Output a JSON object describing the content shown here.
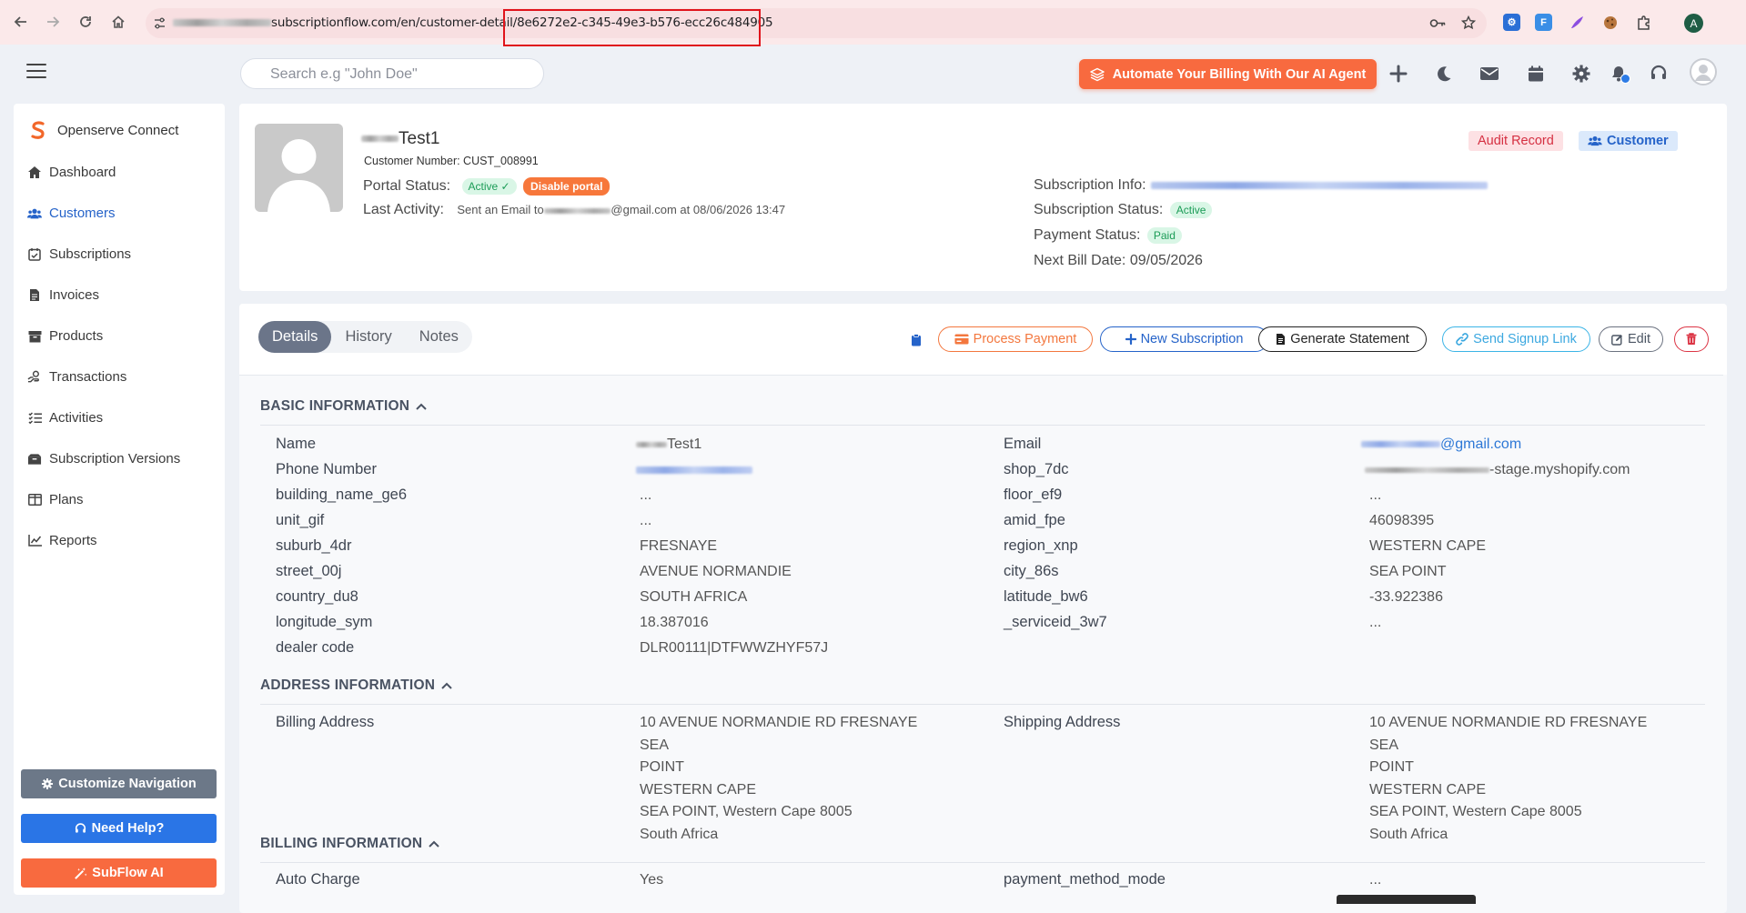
{
  "browser": {
    "url_visible": "subscriptionflow.com/en/customer-detail/",
    "url_id": "8e6272e2-c345-49e3-b576-ecc26c484905",
    "profile_initial": "A"
  },
  "header": {
    "search_placeholder": "Search e.g \"John Doe\"",
    "promo_label": "Automate Your Billing With Our AI Agent"
  },
  "sidebar": {
    "brand": "Openserve Connect",
    "items": [
      {
        "label": "Dashboard",
        "icon": "home-icon"
      },
      {
        "label": "Customers",
        "icon": "users-icon",
        "active": true
      },
      {
        "label": "Subscriptions",
        "icon": "calendar-check-icon"
      },
      {
        "label": "Invoices",
        "icon": "invoice-icon"
      },
      {
        "label": "Products",
        "icon": "box-icon"
      },
      {
        "label": "Transactions",
        "icon": "hand-coin-icon"
      },
      {
        "label": "Activities",
        "icon": "list-check-icon"
      },
      {
        "label": "Subscription Versions",
        "icon": "boxes-icon"
      },
      {
        "label": "Plans",
        "icon": "columns-icon"
      },
      {
        "label": "Reports",
        "icon": "chart-line-icon"
      }
    ],
    "customize_label": "Customize Navigation",
    "help_label": "Need Help?",
    "ai_label": "SubFlow AI"
  },
  "customer": {
    "name_suffix": "Test1",
    "customer_number": "Customer Number: CUST_008991",
    "portal_status_label": "Portal Status:",
    "portal_status_value": "Active",
    "disable_portal_label": "Disable portal",
    "last_activity_label": "Last Activity:",
    "last_activity_prefix": "Sent an Email to",
    "last_activity_suffix": "@gmail.com at 08/06/2026 13:47",
    "audit_label": "Audit Record",
    "customer_badge": "Customer",
    "subscription_info_label": "Subscription Info:",
    "subscription_status_label": "Subscription Status:",
    "subscription_status_value": "Active",
    "payment_status_label": "Payment Status:",
    "payment_status_value": "Paid",
    "next_bill_label": "Next Bill Date:",
    "next_bill_value": "09/05/2026"
  },
  "details": {
    "tabs": [
      "Details",
      "History",
      "Notes"
    ],
    "actions": {
      "process_payment": "Process Payment",
      "new_subscription": "New Subscription",
      "generate_statement": "Generate Statement",
      "send_signup_link": "Send Signup Link",
      "edit": "Edit"
    },
    "basic_title": "BASIC INFORMATION",
    "basic_left": [
      {
        "label": "Name",
        "value": "Test1"
      },
      {
        "label": "Phone Number",
        "value": ""
      },
      {
        "label": "building_name_ge6",
        "value": "..."
      },
      {
        "label": "unit_gif",
        "value": "..."
      },
      {
        "label": "suburb_4dr",
        "value": "FRESNAYE"
      },
      {
        "label": "street_00j",
        "value": "AVENUE NORMANDIE"
      },
      {
        "label": "country_du8",
        "value": "SOUTH AFRICA"
      },
      {
        "label": "longitude_sym",
        "value": "18.387016"
      },
      {
        "label": "dealer code",
        "value": "DLR00111|DTFWWZHYF57J"
      }
    ],
    "basic_right": [
      {
        "label": "Email",
        "value": "@gmail.com"
      },
      {
        "label": "shop_7dc",
        "value": "-stage.myshopify.com"
      },
      {
        "label": "floor_ef9",
        "value": "..."
      },
      {
        "label": "amid_fpe",
        "value": "46098395"
      },
      {
        "label": "region_xnp",
        "value": "WESTERN CAPE"
      },
      {
        "label": "city_86s",
        "value": "SEA POINT"
      },
      {
        "label": "latitude_bw6",
        "value": "-33.922386"
      },
      {
        "label": "_serviceid_3w7",
        "value": "..."
      }
    ],
    "address_title": "ADDRESS INFORMATION",
    "billing_address_label": "Billing Address",
    "billing_address": "10 AVENUE NORMANDIE RD FRESNAYE SEA\nPOINT\nWESTERN CAPE\nSEA POINT, Western Cape 8005\nSouth Africa",
    "shipping_address_label": "Shipping Address",
    "shipping_address": "10 AVENUE NORMANDIE RD FRESNAYE SEA\nPOINT\nWESTERN CAPE\nSEA POINT, Western Cape 8005\nSouth Africa",
    "billing_title": "BILLING INFORMATION",
    "auto_charge_label": "Auto Charge",
    "auto_charge_value": "Yes",
    "payment_method_label": "payment_method_mode",
    "payment_method_value": "..."
  },
  "colors": {
    "accent": "#2563c9",
    "promo": "#f86a3f",
    "help": "#2a75e6",
    "customize": "#6c7888"
  }
}
